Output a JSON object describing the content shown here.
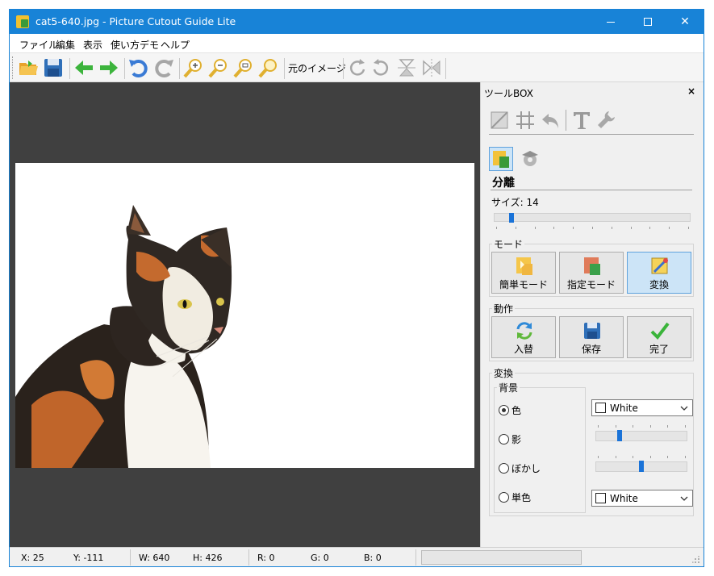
{
  "window": {
    "title": "cat5-640.jpg - Picture Cutout Guide Lite"
  },
  "menu": {
    "items": [
      "ファイル",
      "編集",
      "表示",
      "使い方デモ",
      "ヘルプ"
    ]
  },
  "toolbar": {
    "buttons": [
      {
        "name": "open-folder-icon",
        "color": "#e8a32a"
      },
      {
        "name": "save-disk-icon",
        "color": "#2f6fb8"
      },
      {
        "name": "back-arrow-icon",
        "color": "#3cb43c"
      },
      {
        "name": "forward-arrow-icon",
        "color": "#3cb43c"
      },
      {
        "name": "undo-icon",
        "color": "#3a7bd5"
      },
      {
        "name": "redo-icon",
        "color": "#a6a6a6"
      },
      {
        "name": "zoom-in-icon",
        "color": "#e0b030"
      },
      {
        "name": "zoom-out-icon",
        "color": "#e0b030"
      },
      {
        "name": "zoom-fit-icon",
        "color": "#e0b030"
      },
      {
        "name": "zoom-actual-icon",
        "color": "#e0b030"
      },
      {
        "name": "rotate-right-icon",
        "color": "#a6a6a6"
      },
      {
        "name": "rotate-left-icon",
        "color": "#a6a6a6"
      },
      {
        "name": "flip-vertical-icon",
        "color": "#a6a6a6"
      },
      {
        "name": "flip-horizontal-icon",
        "color": "#a6a6a6"
      }
    ],
    "original_image_label": "元のイメージ"
  },
  "toolbox": {
    "title": "ツールBOX",
    "close_label": "×",
    "section_title": "分離",
    "size_label": "サイズ: 14",
    "size_level": 0.08,
    "mode": {
      "label": "モード",
      "buttons": [
        {
          "label": "簡単モード",
          "selected": false
        },
        {
          "label": "指定モード",
          "selected": false
        },
        {
          "label": "変換",
          "selected": true
        }
      ]
    },
    "action": {
      "label": "動作",
      "buttons": [
        {
          "label": "入替"
        },
        {
          "label": "保存"
        },
        {
          "label": "完了"
        }
      ]
    },
    "convert": {
      "label": "変換",
      "background_label": "背景",
      "options": [
        {
          "label": "色",
          "checked": true
        },
        {
          "label": "影",
          "checked": false
        },
        {
          "label": "ぼかし",
          "checked": false
        },
        {
          "label": "単色",
          "checked": false
        }
      ],
      "color_combo_value": "White",
      "mono_combo_value": "White",
      "shadow_level": 0.25,
      "blur_level": 0.5
    }
  },
  "status": {
    "x": "X: 25",
    "y": "Y: -111",
    "w": "W: 640",
    "h": "H: 426",
    "r": "R: 0",
    "g": "G: 0",
    "b": "B: 0"
  },
  "colors": {
    "titlebar": "#1883d7",
    "canvas_bg": "#404040",
    "selected_button": "#cce4f7",
    "slider_thumb": "#1a73d8"
  }
}
